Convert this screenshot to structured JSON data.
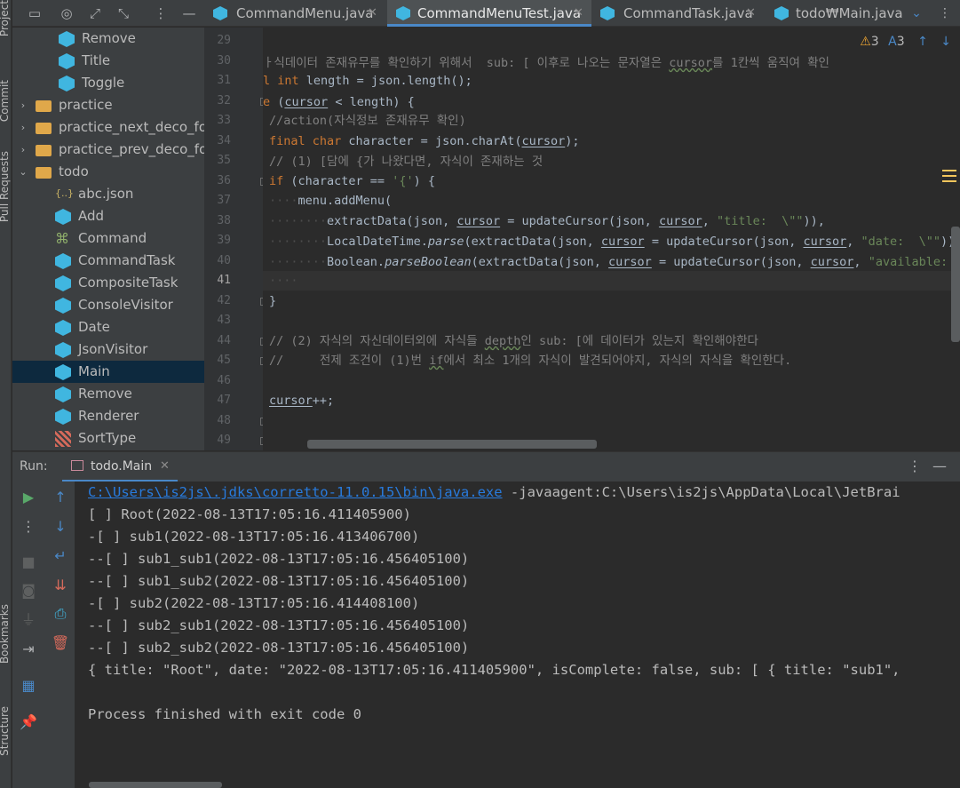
{
  "left_strip": {
    "tabs": [
      "Project",
      "Commit",
      "Pull Requests",
      "Bookmarks",
      "Structure"
    ]
  },
  "project_tree": {
    "items": [
      {
        "label": "Remove",
        "icon": "java-class-icon",
        "indent": 2,
        "selected": false
      },
      {
        "label": "Title",
        "icon": "java-class-icon",
        "indent": 2,
        "selected": false
      },
      {
        "label": "Toggle",
        "icon": "java-class-icon",
        "indent": 2,
        "selected": false
      },
      {
        "label": "practice",
        "icon": "folder-icon",
        "indent": 0,
        "arrow": "›",
        "selected": false
      },
      {
        "label": "practice_next_deco_for_a",
        "icon": "folder-icon",
        "indent": 0,
        "arrow": "›",
        "selected": false
      },
      {
        "label": "practice_prev_deco_for_s",
        "icon": "folder-icon",
        "indent": 0,
        "arrow": "›",
        "selected": false
      },
      {
        "label": "todo",
        "icon": "folder-icon",
        "indent": 0,
        "arrow": "⌄",
        "selected": false
      },
      {
        "label": "abc.json",
        "icon": "json-file-icon",
        "indent": 1,
        "selected": false
      },
      {
        "label": "Add",
        "icon": "java-class-icon",
        "indent": 1,
        "selected": false
      },
      {
        "label": "Command",
        "icon": "interface-icon",
        "indent": 1,
        "selected": false
      },
      {
        "label": "CommandTask",
        "icon": "java-class-icon",
        "indent": 1,
        "selected": false
      },
      {
        "label": "CompositeTask",
        "icon": "java-class-icon",
        "indent": 1,
        "selected": false
      },
      {
        "label": "ConsoleVisitor",
        "icon": "java-class-icon",
        "indent": 1,
        "selected": false
      },
      {
        "label": "Date",
        "icon": "java-class-icon",
        "indent": 1,
        "selected": false
      },
      {
        "label": "JsonVisitor",
        "icon": "java-class-icon",
        "indent": 1,
        "selected": false
      },
      {
        "label": "Main",
        "icon": "java-main-class-icon",
        "indent": 1,
        "selected": true
      },
      {
        "label": "Remove",
        "icon": "java-class-icon",
        "indent": 1,
        "selected": false
      },
      {
        "label": "Renderer",
        "icon": "java-class-icon",
        "indent": 1,
        "selected": false
      },
      {
        "label": "SortType",
        "icon": "enum-icon",
        "indent": 1,
        "selected": false
      }
    ]
  },
  "editor_tabs": [
    {
      "label": "CommandMenu.java",
      "active": false
    },
    {
      "label": "CommandMenuTest.java",
      "active": true
    },
    {
      "label": "CommandTask.java",
      "active": false
    },
    {
      "label": "todo₩Main.java",
      "active": false
    }
  ],
  "inspections": {
    "warnings": "3",
    "typos": "3"
  },
  "editor": {
    "line_numbers": [
      "29",
      "30",
      "31",
      "32",
      "33",
      "34",
      "35",
      "36",
      "37",
      "38",
      "39",
      "40",
      "41",
      "42",
      "43",
      "44",
      "45",
      "46",
      "47",
      "48",
      "49"
    ],
    "current_line": "41"
  },
  "run": {
    "label": "Run:",
    "config": "todo.Main",
    "java_path": "C:\\Users\\is2js\\.jdks\\corretto-11.0.15\\bin\\java.exe",
    "java_args": " -javaagent:C:\\Users\\is2js\\AppData\\Local\\JetBrai",
    "output": [
      "[ ] Root(2022-08-13T17:05:16.411405900)",
      "-[ ] sub1(2022-08-13T17:05:16.413406700)",
      "--[ ] sub1_sub1(2022-08-13T17:05:16.456405100)",
      "--[ ] sub1_sub2(2022-08-13T17:05:16.456405100)",
      "-[ ] sub2(2022-08-13T17:05:16.414408100)",
      "--[ ] sub2_sub1(2022-08-13T17:05:16.456405100)",
      "--[ ] sub2_sub2(2022-08-13T17:05:16.456405100)",
      "{ title: \"Root\", date: \"2022-08-13T17:05:16.411405900\", isComplete: false, sub: [ { title: \"sub1\",",
      "",
      "Process finished with exit code 0"
    ]
  },
  "colors": {
    "accent": "#4a88c7",
    "keyword": "#cc7832",
    "string": "#6a8759",
    "comment": "#808080",
    "link": "#287bde",
    "selection": "#0d293e"
  }
}
